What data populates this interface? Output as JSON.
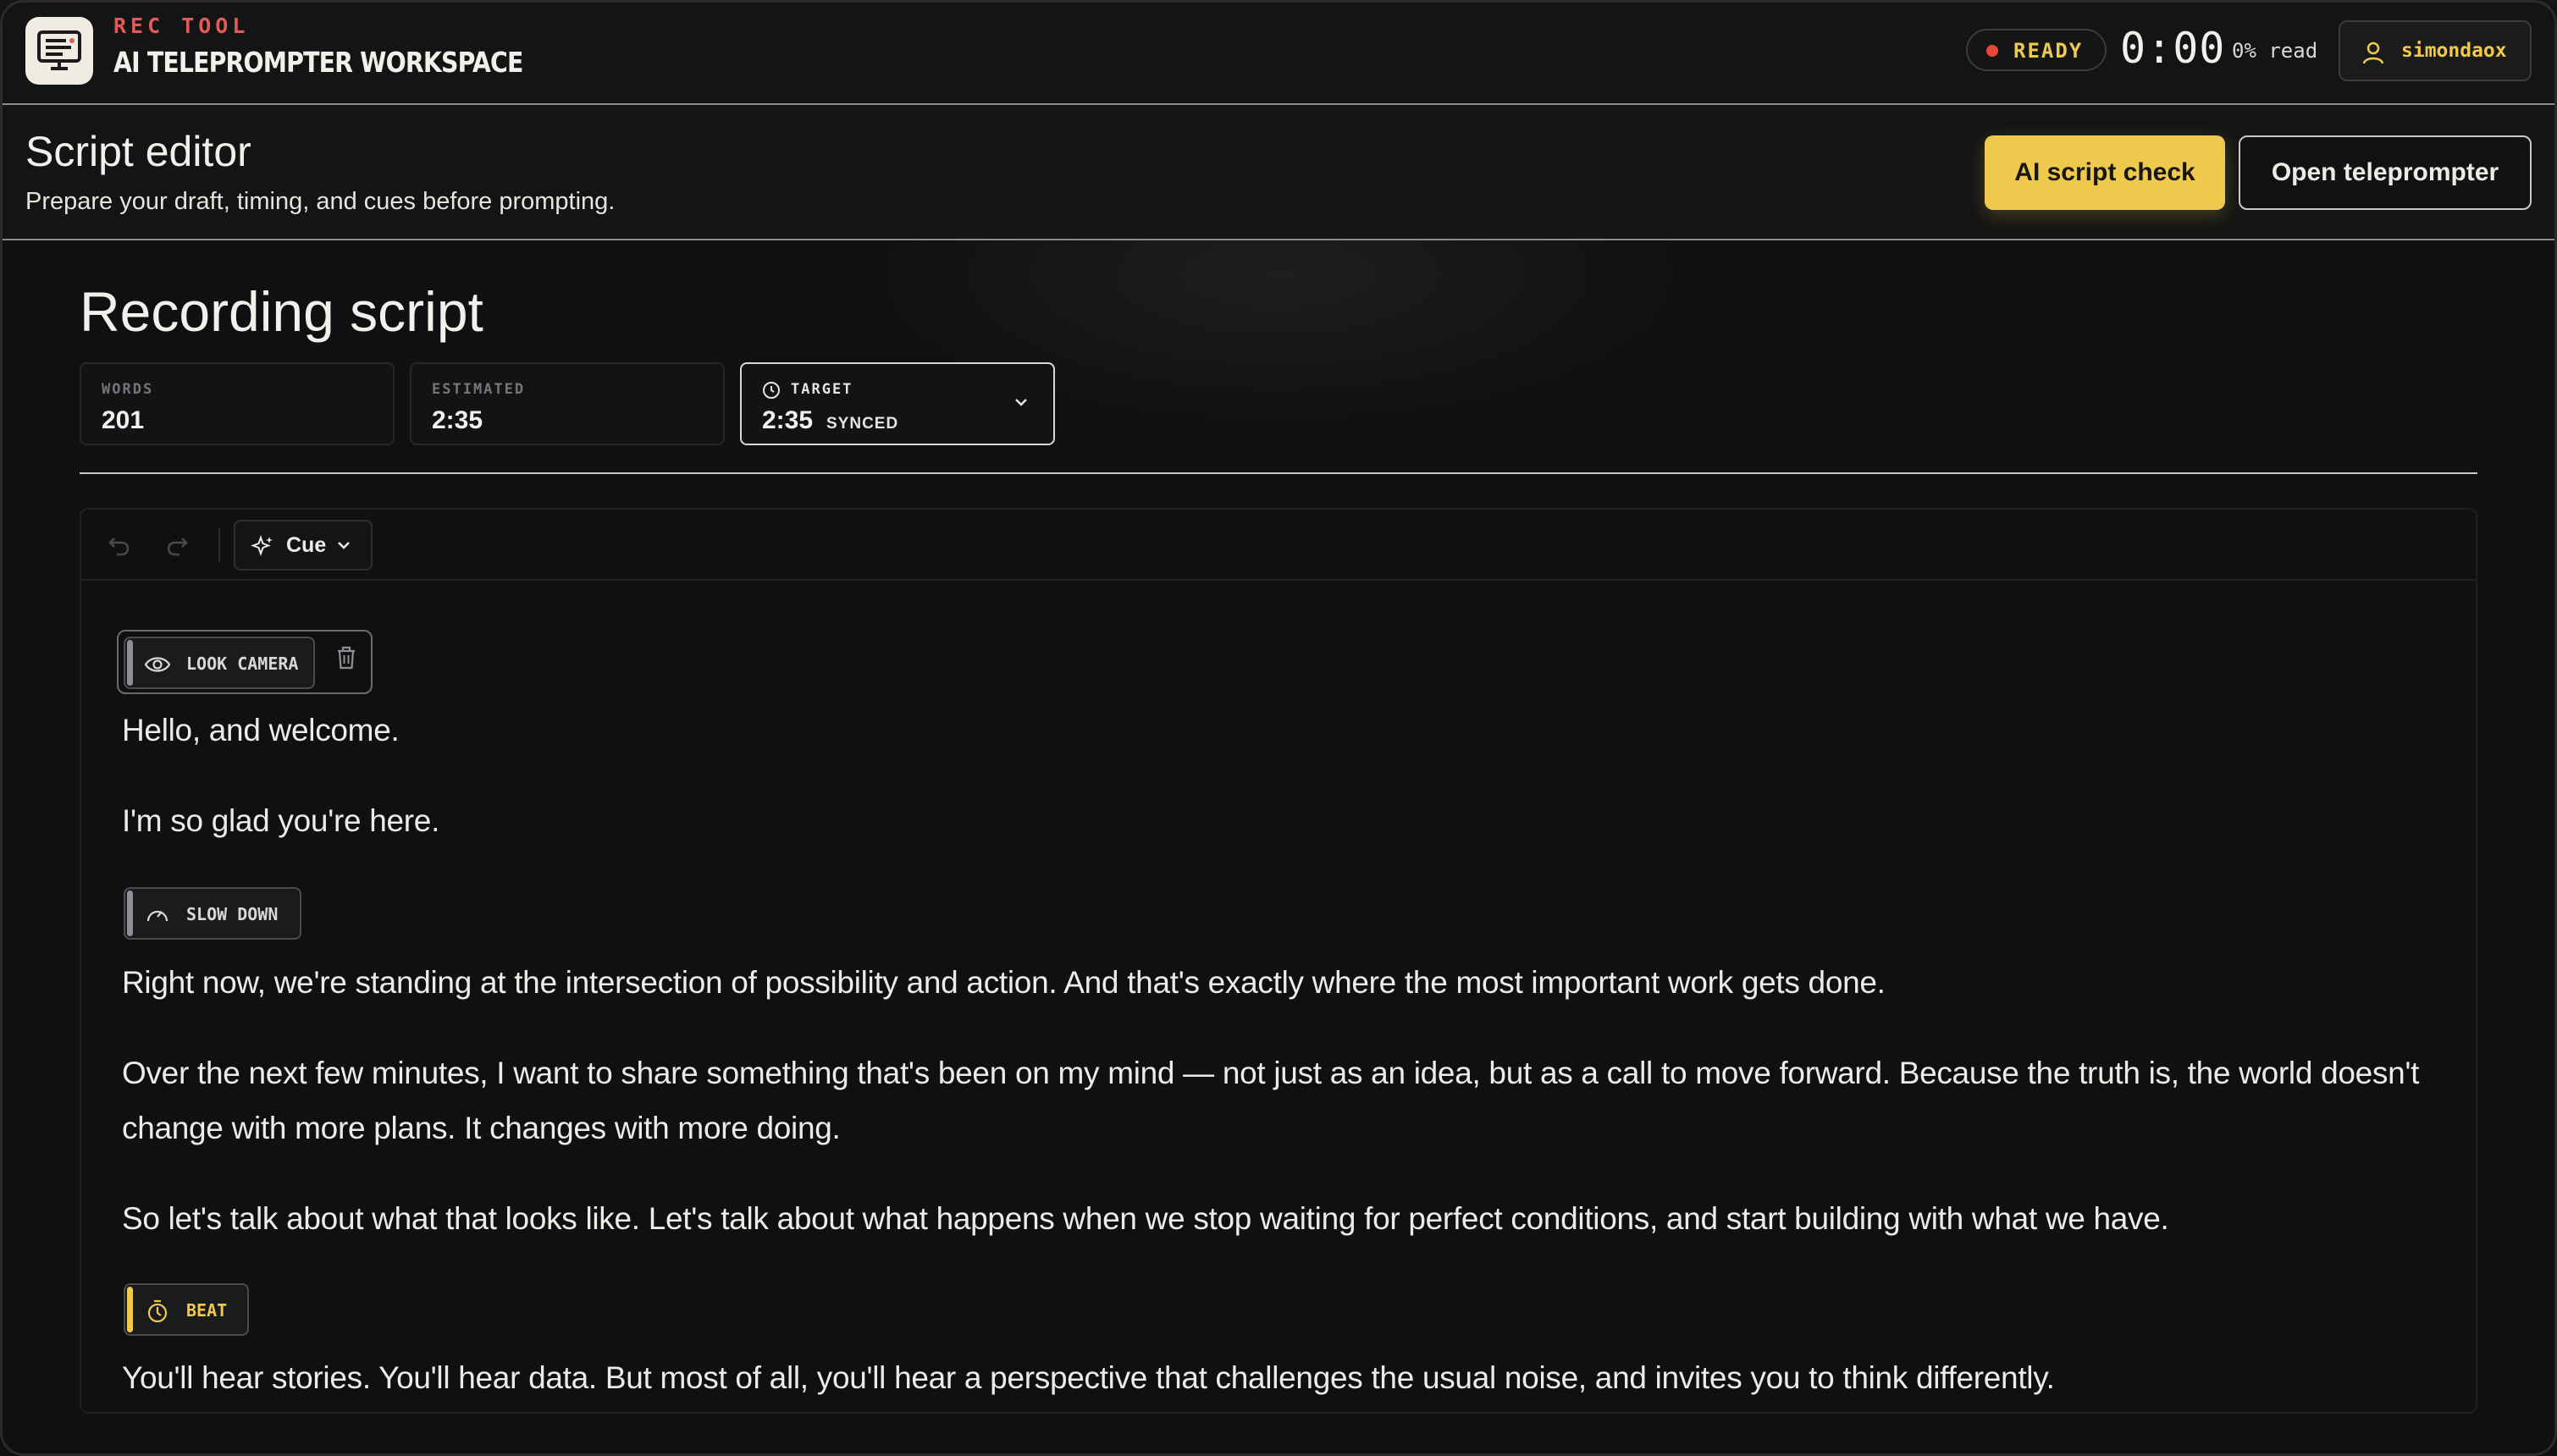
{
  "app": {
    "kicker": "REC TOOL",
    "title": "AI TELEPROMPTER WORKSPACE",
    "icon": "teleprompter-icon"
  },
  "status": {
    "label": "READY",
    "dot_color": "#e8453f",
    "timer": "0:00",
    "read_progress": "0% read"
  },
  "user": {
    "name": "simondaox",
    "icon": "user-icon"
  },
  "page": {
    "title": "Script editor",
    "subtitle": "Prepare your draft, timing, and cues before prompting.",
    "ai_check_label": "AI script check",
    "open_label": "Open teleprompter"
  },
  "script": {
    "title": "Recording script",
    "stats": {
      "words_label": "WORDS",
      "words_value": "201",
      "estimated_label": "ESTIMATED",
      "estimated_value": "2:35",
      "target_label": "TARGET",
      "target_value": "2:35",
      "target_status": "SYNCED"
    }
  },
  "toolbar": {
    "undo_icon": "undo-icon",
    "redo_icon": "redo-icon",
    "cue_label": "Cue"
  },
  "content": {
    "cue1": "LOOK CAMERA",
    "p1": "Hello, and welcome.",
    "p2": "I'm so glad you're here.",
    "cue2": "SLOW DOWN",
    "p3": "Right now, we're standing at the intersection of possibility and action. And that's exactly where the most important work gets done.",
    "p4": "Over the next few minutes, I want to share something that's been on my mind — not just as an idea, but as a call to move forward. Because the truth is, the world doesn't change with more plans. It changes with more doing.",
    "p5": "So let's talk about what that looks like. Let's talk about what happens when we stop waiting for perfect conditions, and start building with what we have.",
    "cue3": "BEAT",
    "p6": "You'll hear stories. You'll hear data. But most of all, you'll hear a perspective that challenges the usual noise, and invites you to think differently."
  },
  "colors": {
    "accent": "#efc94e",
    "danger": "#e05a57",
    "background": "#0f1011"
  }
}
